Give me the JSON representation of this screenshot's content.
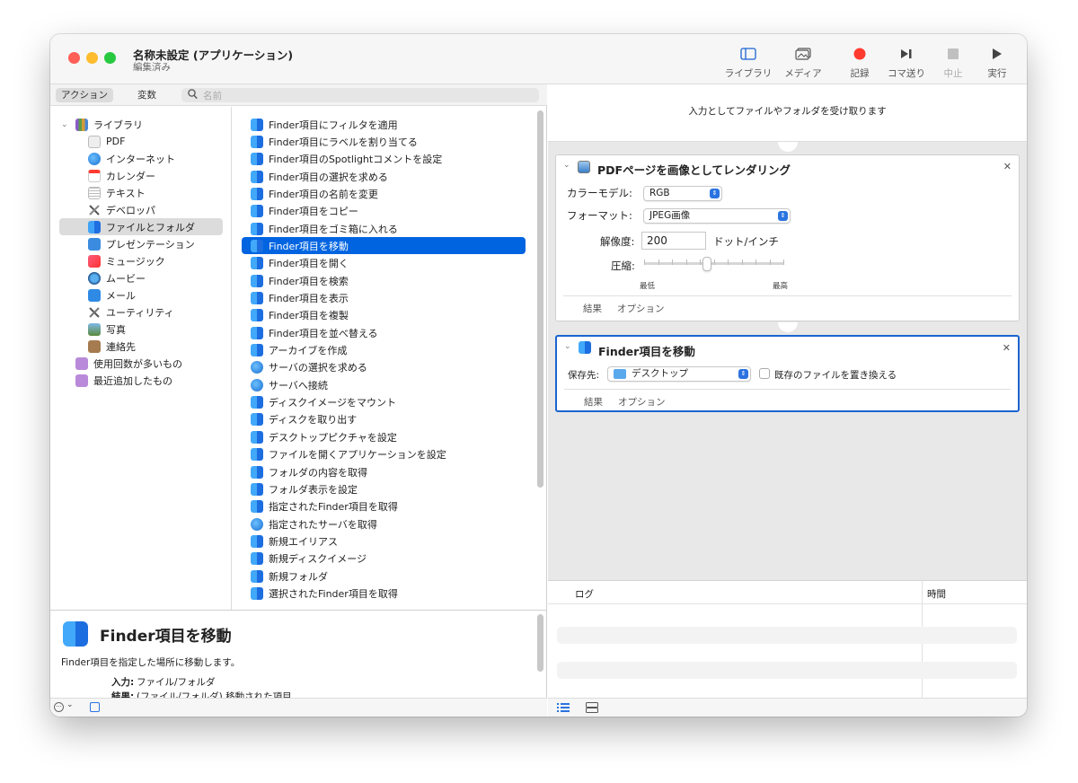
{
  "window": {
    "title": "名称未設定 (アプリケーション)",
    "subtitle": "編集済み"
  },
  "toolbar": {
    "library": "ライブラリ",
    "media": "メディア",
    "record": "記録",
    "step": "コマ送り",
    "stop": "中止",
    "run": "実行"
  },
  "filter": {
    "actions_tab": "アクション",
    "variables_tab": "変数",
    "search_placeholder": "名前"
  },
  "library": {
    "root": "ライブラリ",
    "items": [
      "PDF",
      "インターネット",
      "カレンダー",
      "テキスト",
      "デベロッパ",
      "ファイルとフォルダ",
      "プレゼンテーション",
      "ミュージック",
      "ムービー",
      "メール",
      "ユーティリティ",
      "写真",
      "連絡先"
    ],
    "selected": "ファイルとフォルダ",
    "smart": [
      "使用回数が多いもの",
      "最近追加したもの"
    ]
  },
  "actions": {
    "items": [
      "Finder項目にフィルタを適用",
      "Finder項目にラベルを割り当てる",
      "Finder項目のSpotlightコメントを設定",
      "Finder項目の選択を求める",
      "Finder項目の名前を変更",
      "Finder項目をコピー",
      "Finder項目をゴミ箱に入れる",
      "Finder項目を移動",
      "Finder項目を開く",
      "Finder項目を検索",
      "Finder項目を表示",
      "Finder項目を複製",
      "Finder項目を並べ替える",
      "アーカイブを作成",
      "サーバの選択を求める",
      "サーバへ接続",
      "ディスクイメージをマウント",
      "ディスクを取り出す",
      "デスクトップピクチャを設定",
      "ファイルを開くアプリケーションを設定",
      "フォルダの内容を取得",
      "フォルダ表示を設定",
      "指定されたFinder項目を取得",
      "指定されたサーバを取得",
      "新規エイリアス",
      "新規ディスクイメージ",
      "新規フォルダ",
      "選択されたFinder項目を取得"
    ],
    "selected": "Finder項目を移動"
  },
  "description": {
    "title": "Finder項目を移動",
    "text": "Finder項目を指定した場所に移動します。",
    "input_label": "入力:",
    "input_value": "ファイル/フォルダ",
    "result_label": "結果:",
    "result_value": "(ファイル/フォルダ) 移動された項目"
  },
  "workflow": {
    "input_message": "入力としてファイルやフォルダを受け取ります",
    "card1": {
      "title": "PDFページを画像としてレンダリング",
      "color_model_label": "カラーモデル:",
      "color_model_value": "RGB",
      "format_label": "フォーマット:",
      "format_value": "JPEG画像",
      "resolution_label": "解像度:",
      "resolution_value": "200",
      "resolution_unit": "ドット/インチ",
      "compression_label": "圧縮:",
      "compression_min": "最低",
      "compression_max": "最高",
      "compression_level": 0.45,
      "results_tab": "結果",
      "options_tab": "オプション"
    },
    "card2": {
      "title": "Finder項目を移動",
      "dest_label": "保存先:",
      "dest_value": "デスクトップ",
      "replace_label": "既存のファイルを置き換える",
      "replace_checked": false,
      "results_tab": "結果",
      "options_tab": "オプション"
    }
  },
  "log": {
    "col_log": "ログ",
    "col_time": "時間"
  },
  "colors": {
    "accent": "#0064e1",
    "record": "#ff3b30",
    "selected_card_border": "#1b64d1"
  }
}
